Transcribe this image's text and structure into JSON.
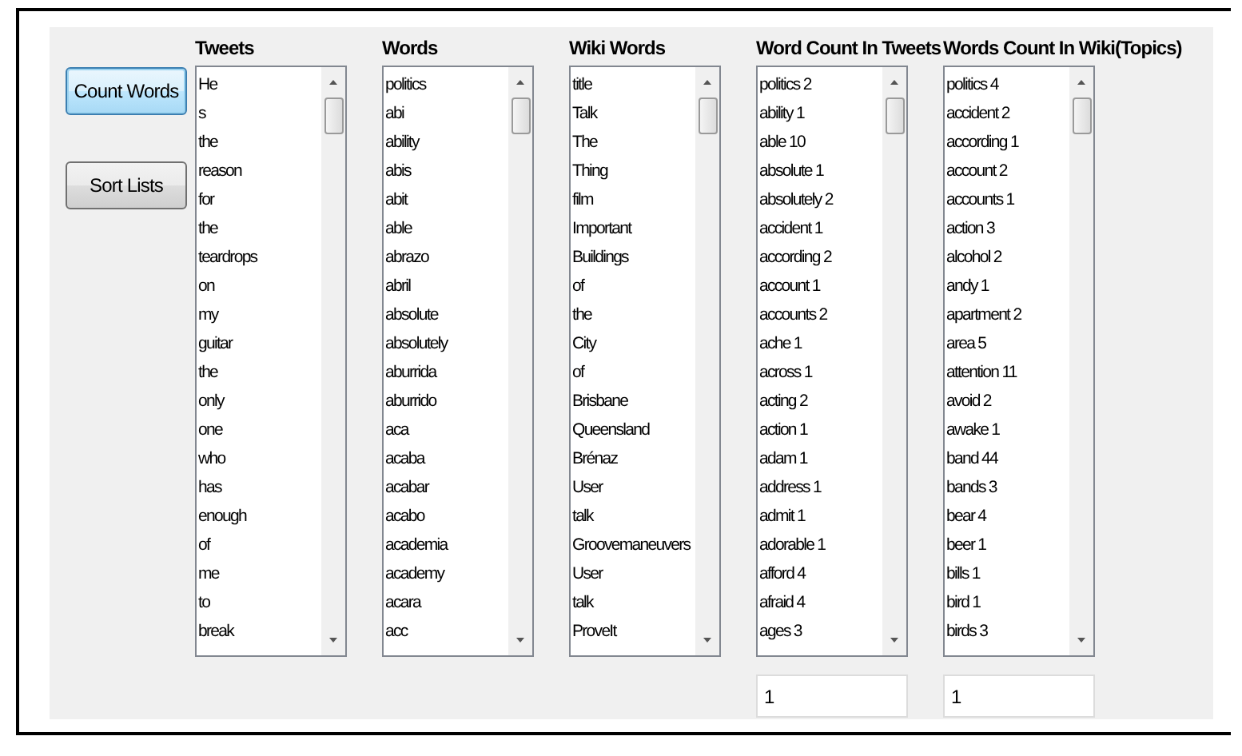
{
  "buttons": [
    {
      "label": "Count Words",
      "focused": true
    },
    {
      "label": "Sort Lists",
      "focused": false
    }
  ],
  "lists": [
    {
      "title": "Tweets",
      "items": [
        "He",
        "s",
        "the",
        "reason",
        "for",
        "the",
        "teardrops",
        "on",
        "my",
        "guitar",
        "the",
        "only",
        "one",
        "who",
        "has",
        "enough",
        "of",
        "me",
        "to",
        "break"
      ]
    },
    {
      "title": "Words",
      "items": [
        "politics",
        "abi",
        "ability",
        "abis",
        "abit",
        "able",
        "abrazo",
        "abril",
        "absolute",
        "absolutely",
        "aburrida",
        "aburrido",
        "aca",
        "acaba",
        "acabar",
        "acabo",
        "academia",
        "academy",
        "acara",
        "acc"
      ]
    },
    {
      "title": "Wiki Words",
      "items": [
        "title",
        "Talk",
        "The",
        "Thing",
        "film",
        "Important",
        "Buildings",
        "of",
        "the",
        "City",
        "of",
        "Brisbane",
        "Queensland",
        "Brénaz",
        "User",
        "talk",
        "Groovemaneuvers",
        "User",
        "talk",
        "ProveIt"
      ]
    },
    {
      "title": "Word Count In Tweets",
      "items": [
        "politics 2",
        "ability 1",
        "able 10",
        "absolute 1",
        "absolutely 2",
        "accident 1",
        "according 2",
        "account 1",
        "accounts 2",
        "ache 1",
        "across 1",
        "acting 2",
        "action 1",
        "adam 1",
        "address 1",
        "admit 1",
        "adorable 1",
        "afford 4",
        "afraid 4",
        "ages 3"
      ],
      "field": {
        "value": "1"
      }
    },
    {
      "title": "Words Count In Wiki(Topics)",
      "items": [
        "politics 4",
        "accident 2",
        "according 1",
        "account 2",
        "accounts 1",
        "action 3",
        "alcohol 2",
        "andy 1",
        "apartment 2",
        "area 5",
        "attention 11",
        "avoid 2",
        "awake 1",
        "band 44",
        "bands 3",
        "bear 4",
        "beer 1",
        "bills 1",
        "bird 1",
        "birds 3"
      ],
      "field": {
        "value": "1"
      }
    }
  ]
}
